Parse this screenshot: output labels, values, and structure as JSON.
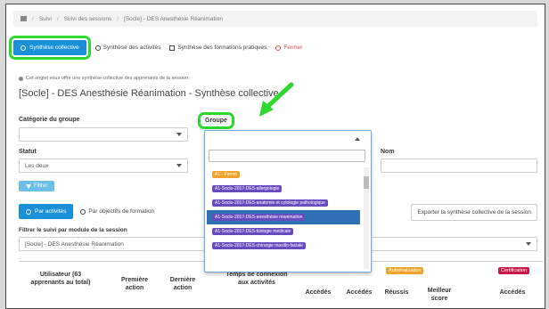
{
  "breadcrumb": [
    "Suivi",
    "Suivi des sessions",
    "[Socle] - DES Anesthésie Réanimation"
  ],
  "tabs": {
    "synthese_collective": "Synthèse collective",
    "synthese_activites": "Synthèse des activités",
    "synthese_formations": "Synthèse des formations pratiques",
    "fermer": "Fermer"
  },
  "info_text": "Cet onglet vous offre une synthèse collective des apprenants de la session.",
  "page_title": "[Socle] - DES Anesthésie Réanimation - Synthèse collective",
  "filters": {
    "categorie_label": "Catégorie du groupe",
    "groupe_label": "Groupe",
    "statut_label": "Statut",
    "statut_value": "Les deux",
    "nom_label": "Nom",
    "filtrer_button": "Filtrer"
  },
  "view_buttons": {
    "par_activites": "Par activités",
    "par_objectifs": "Par objectifs de formation",
    "export": "Exporter la synthèse collective de la session"
  },
  "module_filter": {
    "label": "Filtrer le suivi par module de la session",
    "value": "[Socle] - DES Anesthésie Réanimation"
  },
  "dropdown": {
    "items": [
      {
        "label": "A1 - Formé",
        "color": "#f0a32a"
      },
      {
        "label": "A1-Socle-2017-DES-allergologie",
        "color": "#6a4bbf"
      },
      {
        "label": "A1-Socle-2017-DES-anatomie et cytologie pathologique",
        "color": "#6a4bbf"
      },
      {
        "label": "A1-Socle-2017-DES-anesthésie réanimation",
        "color": "#6a4bbf"
      },
      {
        "label": "A1-Socle-2017-DES-biologie médicale",
        "color": "#6a4bbf"
      },
      {
        "label": "A1-Socle-2017-DES-chirurgie maxillo-faciale",
        "color": "#6a4bbf"
      }
    ]
  },
  "table": {
    "headers": {
      "utilisateur": "Utilisateur (63 apprenants au total)",
      "premiere": "Première action",
      "derniere": "Dernière action",
      "temps": "Temps de connexion aux activités",
      "accedes1": "Accédés",
      "accedes2": "Accédés",
      "reussis": "Réussis",
      "meilleur": "Meilleur score",
      "accedes3": "Accédés"
    },
    "badges": {
      "autoevaluation": "Autoévaluation",
      "certification": "Certification"
    }
  },
  "colors": {
    "primary": "#1a90d9",
    "highlight": "#2ed82e",
    "badge_orange": "#f0a32a",
    "badge_red": "#c9184a",
    "pill_purple": "#6a4bbf",
    "active_row": "#2f6fb3"
  }
}
